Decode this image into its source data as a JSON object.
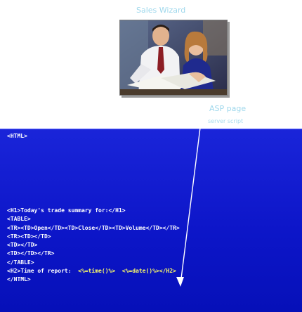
{
  "captions": {
    "title": "Sales Wizard",
    "pointer_a": "ASP page",
    "pointer_b": "server script"
  },
  "photo": {
    "icon": "two-people-at-desk-photo"
  },
  "code": {
    "open_html": "<HTML>",
    "lines": [
      "<H1>Today's trade summary for:</H1>",
      "<TABLE>",
      "<TR><TD>Open</TD><TD>Close</TD><TD>Volume</TD></TR>",
      "<TR><TD></TD>",
      "<TD></TD>",
      "<TD></TD></TR>",
      "</TABLE>"
    ],
    "report_prefix": "<H2>Time of report:  ",
    "report_script": "<%=time()%>  <%=date()%></H2>",
    "close_html": "</HTML>"
  },
  "colors": {
    "panel": "#0d16c9",
    "code_text": "#ffffff",
    "script_highlight": "#ffff66",
    "caption": "#9fd8ec",
    "arrow": "#ffffff"
  }
}
